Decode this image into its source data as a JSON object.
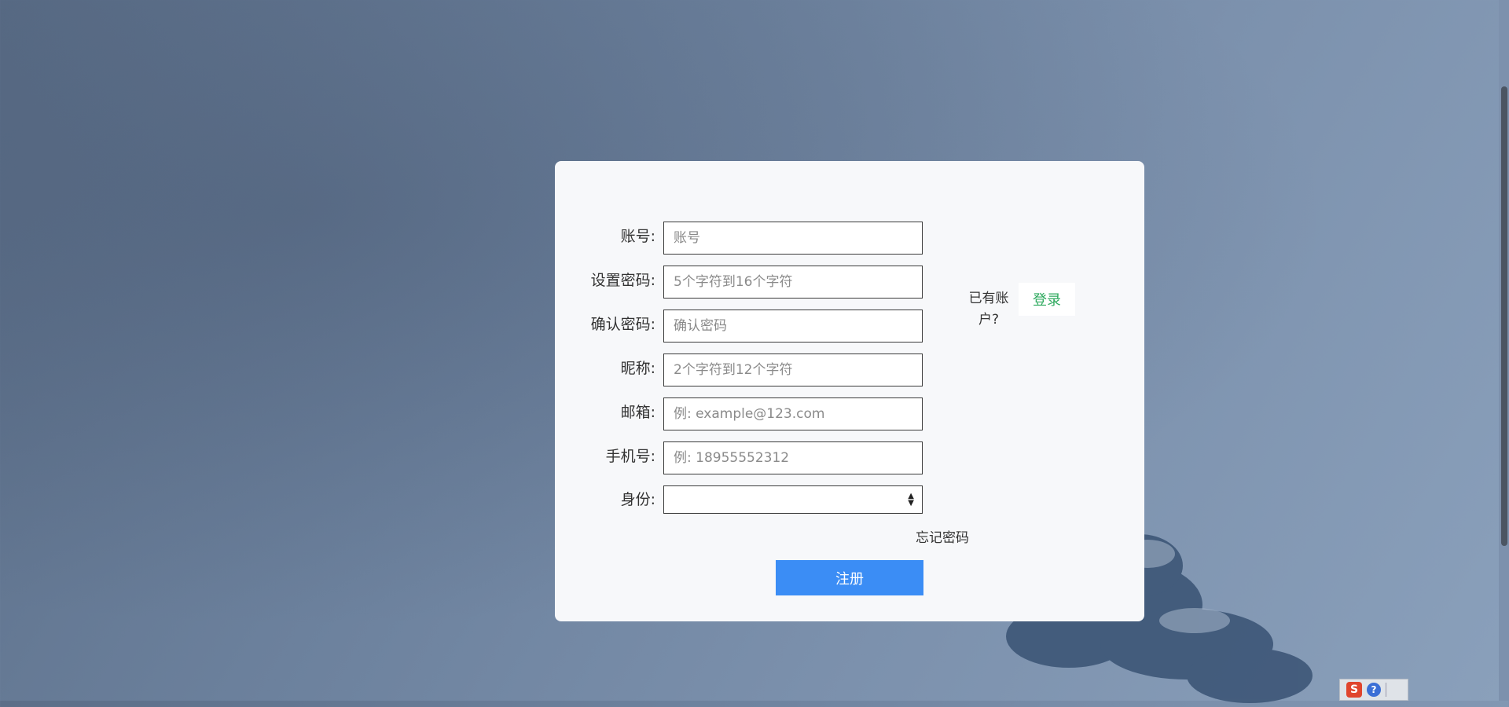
{
  "form": {
    "fields": [
      {
        "label": "账号:",
        "placeholder": "账号"
      },
      {
        "label": "设置密码:",
        "placeholder": "5个字符到16个字符"
      },
      {
        "label": "确认密码:",
        "placeholder": "确认密码"
      },
      {
        "label": "昵称:",
        "placeholder": "2个字符到12个字符"
      },
      {
        "label": "邮箱:",
        "placeholder": "例: example@123.com"
      },
      {
        "label": "手机号:",
        "placeholder": "例: 18955552312"
      }
    ],
    "identity": {
      "label": "身份:",
      "value": ""
    },
    "forgot_label": "忘记密码",
    "register_label": "注册"
  },
  "side": {
    "have_account_text": "已有账户?",
    "login_label": "登录"
  },
  "ime": {
    "sogou_glyph": "S",
    "help_glyph": "?"
  },
  "colors": {
    "primary": "#3b8df5",
    "login_text": "#2faa5f"
  }
}
